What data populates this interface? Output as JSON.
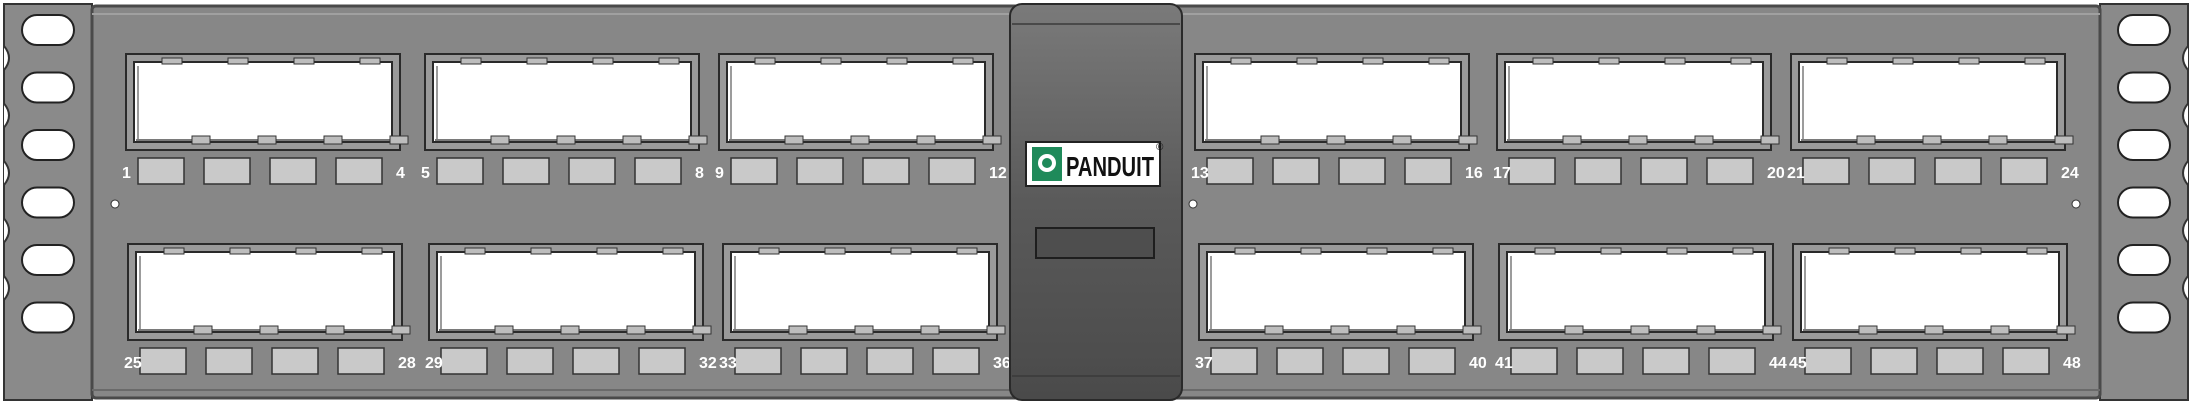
{
  "product": {
    "name": "48-port modular patch panel",
    "brand": "PANDUIT",
    "registered_mark": "®"
  },
  "colors": {
    "panel_face": "#878787",
    "panel_edge": "#5a5a5a",
    "ear": "#8a8a8a",
    "bay_outline": "#2a2a2a",
    "module_face": "#ffffff",
    "label_tab": "#c9c9c9",
    "center_bar": "#555555",
    "text": "#ffffff",
    "logo_green": "#1f8a5a",
    "logo_text": "#111111"
  },
  "rows": [
    {
      "name": "top",
      "bays": [
        {
          "first": "1",
          "last": "4"
        },
        {
          "first": "5",
          "last": "8"
        },
        {
          "first": "9",
          "last": "12"
        },
        {
          "first": "13",
          "last": "16"
        },
        {
          "first": "17",
          "last": "20"
        },
        {
          "first": "21",
          "last": "24"
        }
      ]
    },
    {
      "name": "bottom",
      "bays": [
        {
          "first": "25",
          "last": "28"
        },
        {
          "first": "29",
          "last": "32"
        },
        {
          "first": "33",
          "last": "36"
        },
        {
          "first": "37",
          "last": "40"
        },
        {
          "first": "41",
          "last": "44"
        },
        {
          "first": "45",
          "last": "48"
        }
      ]
    }
  ],
  "ports_per_bay": 4,
  "mounting_slots_per_ear": 6
}
